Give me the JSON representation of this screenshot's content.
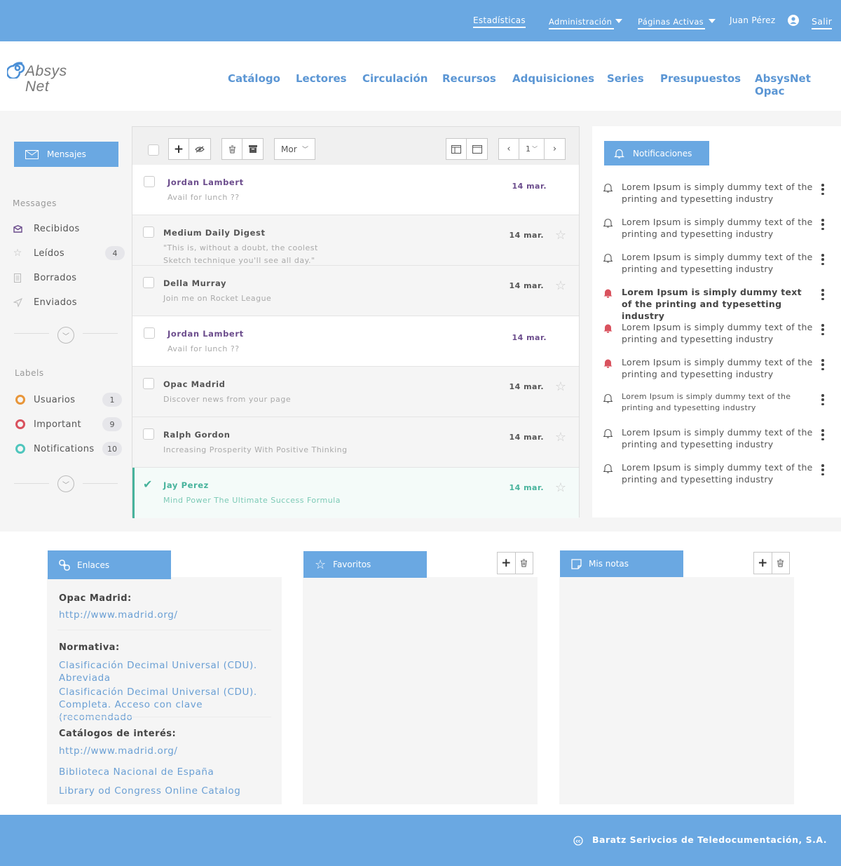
{
  "topbar": {
    "estadisticas": "Estadísticas",
    "administracion": "Administración",
    "paginas_activas": "Páginas Activas",
    "user_name": "Juan Pérez",
    "salir": "Salir"
  },
  "logo": {
    "line1": "Absys",
    "line2": "Net"
  },
  "nav": [
    "Catálogo",
    "Lectores",
    "Circulación",
    "Recursos",
    "Adquisiciones",
    "Series",
    "Presupuestos",
    "AbsysNet Opac"
  ],
  "sidebar": {
    "compose_label": "Mensajes",
    "messages_heading": "Messages",
    "folders": [
      {
        "label": "Recibidos",
        "count": "",
        "icon": "inbox-icon"
      },
      {
        "label": "Leídos",
        "count": "4",
        "icon": "star-icon"
      },
      {
        "label": "Borrados",
        "count": "",
        "icon": "document-icon"
      },
      {
        "label": "Enviados",
        "count": "",
        "icon": "send-icon"
      }
    ],
    "labels_heading": "Labels",
    "labels": [
      {
        "label": "Usuarios",
        "count": "1",
        "color": "#e8963a"
      },
      {
        "label": "Important",
        "count": "9",
        "color": "#d9525e"
      },
      {
        "label": "Notifications",
        "count": "10",
        "color": "#4fc6bd"
      }
    ]
  },
  "toolbar": {
    "more_label": "Mor",
    "page": "1"
  },
  "messages": [
    {
      "name": "Jordan Lambert",
      "preview": "Avail for lunch ??",
      "date": "14 mar.",
      "unread": true,
      "checked": false
    },
    {
      "name": "Medium Daily Digest",
      "preview": "\"This is, without a doubt, the coolest Sketch technique you'll see all day.\"",
      "date": "14 mar.",
      "unread": false,
      "checked": false
    },
    {
      "name": "Della Murray",
      "preview": "Join me on Rocket League",
      "date": "14 mar.",
      "unread": false,
      "checked": false
    },
    {
      "name": "Jordan Lambert",
      "preview": "Avail for lunch ??",
      "date": "14 mar.",
      "unread": true,
      "checked": false
    },
    {
      "name": "Opac Madrid",
      "preview": "Discover news from your page",
      "date": "14 mar.",
      "unread": false,
      "checked": false
    },
    {
      "name": "Ralph Gordon",
      "preview": "Increasing Prosperity With Positive Thinking",
      "date": "14 mar.",
      "unread": false,
      "checked": false
    },
    {
      "name": "Jay Perez",
      "preview": "Mind Power The Ultimate Success Formula",
      "date": "14 mar.",
      "unread": false,
      "checked": true
    }
  ],
  "notifications": {
    "title": "Notificaciones",
    "items": [
      {
        "text": "Lorem Ipsum is simply dummy text of the printing and typesetting industry",
        "alert": false,
        "bold": false
      },
      {
        "text": "Lorem Ipsum is simply dummy text of the printing and typesetting industry",
        "alert": false,
        "bold": false
      },
      {
        "text": "Lorem Ipsum is simply dummy text of the printing and typesetting industry",
        "alert": false,
        "bold": false
      },
      {
        "text": "Lorem Ipsum is simply dummy text of the printing and typesetting industry",
        "alert": true,
        "bold": true
      },
      {
        "text": "Lorem Ipsum is simply dummy text of the printing and typesetting industry",
        "alert": true,
        "bold": false
      },
      {
        "text": "Lorem Ipsum is simply dummy text of the printing and typesetting industry",
        "alert": true,
        "bold": false
      },
      {
        "text": "Lorem Ipsum is simply dummy text of the printing and typesetting industry",
        "alert": false,
        "bold": false,
        "small": true
      },
      {
        "text": "Lorem Ipsum is simply dummy text of the printing and typesetting industry",
        "alert": false,
        "bold": false
      },
      {
        "text": "Lorem Ipsum is simply dummy text of the printing and typesetting industry",
        "alert": false,
        "bold": false
      }
    ]
  },
  "enlaces": {
    "title": "Enlaces",
    "opac_heading": "Opac Madrid:",
    "opac_link": "http://www.madrid.org/",
    "normativa_heading": "Normativa:",
    "normativa_links": [
      "Clasificación Decimal Universal (CDU). Abreviada",
      "Clasificación Decimal Universal (CDU). Completa. Acceso con clave (recomendado"
    ],
    "catalogos_heading": "Catálogos de interés:",
    "catalogos_links": [
      "http://www.madrid.org/",
      "Biblioteca Nacional de España",
      "Library od Congress Online Catalog"
    ]
  },
  "favoritos": {
    "title": "Favoritos"
  },
  "notas": {
    "title": "Mis notas"
  },
  "footer": {
    "text": "Baratz Serivcios de Teledocumentación, S.A."
  },
  "colors": {
    "accent": "#6aa8e2",
    "purple": "#6b4c8c",
    "teal": "#47b39c",
    "alert": "#d9525e"
  }
}
